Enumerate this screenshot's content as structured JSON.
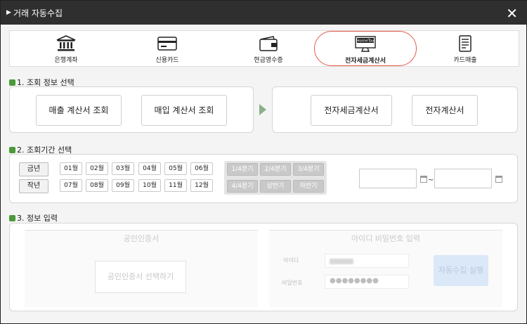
{
  "window": {
    "title": "거래 자동수집"
  },
  "tabs": [
    {
      "label": "은행계좌",
      "icon": "bank-icon"
    },
    {
      "label": "신용카드",
      "icon": "credit-card-icon"
    },
    {
      "label": "현금영수증",
      "icon": "wallet-icon"
    },
    {
      "label": "전자세금계산서",
      "icon": "hometax-icon",
      "icon_text": "HomeTax",
      "active": true
    },
    {
      "label": "카드매출",
      "icon": "document-icon"
    }
  ],
  "section1": {
    "title": "1. 조회 정보 선택",
    "sales_button": "매출 계산서 조회",
    "purchase_button": "매입 계산서 조회",
    "etax_button": "전자세금계산서",
    "einvoice_button": "전자계산서"
  },
  "section2": {
    "title": "2. 조회기간 선택",
    "years": [
      "금년",
      "작년"
    ],
    "months": [
      "01월",
      "02월",
      "03월",
      "04월",
      "05월",
      "06월",
      "07월",
      "08월",
      "09월",
      "10월",
      "11월",
      "12월"
    ],
    "quarters": [
      "1/4분기",
      "2/4분기",
      "3/4분기",
      "4/4분기",
      "상반기",
      "하반기"
    ],
    "range_separator": "~"
  },
  "section3": {
    "title": "3. 정보 입력",
    "cert_panel_title": "공인인증서",
    "cert_button": "공인인증서 선택하기",
    "login_panel_title": "아이디 비밀번호 입력",
    "id_label": "아이디",
    "pw_label": "비밀번호",
    "pw_value": "●●●●●●●●",
    "run_button": "자동수집 실행"
  },
  "colors": {
    "title_bar": "#2f2f2f",
    "active_tab_border": "#e45a4a",
    "section_mark": "#4a9a3a",
    "run_button": "#dbe8f8"
  }
}
